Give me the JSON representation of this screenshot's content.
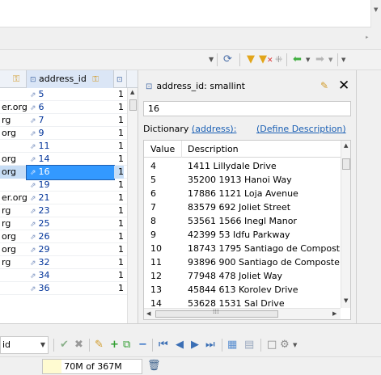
{
  "colors": {
    "selection": "#3399ff",
    "link": "#1a5fb4",
    "memory_fill": "#fffbd1"
  },
  "toolbar": {
    "icons": [
      "dropdown-icon",
      "refresh-icon",
      "filter-icon",
      "clear-filter-icon",
      "columns-icon",
      "back-icon",
      "forward-icon",
      "more-icon"
    ]
  },
  "grid": {
    "columns": [
      {
        "label": "",
        "icon": "key-sort-icon"
      },
      {
        "label": "address_id",
        "icon": "key-column-icon"
      },
      {
        "label": "",
        "icon": "column-icon"
      }
    ],
    "rows": [
      {
        "left": "",
        "id": "5",
        "right": "1"
      },
      {
        "left": "er.org",
        "id": "6",
        "right": "1"
      },
      {
        "left": "rg",
        "id": "7",
        "right": "1"
      },
      {
        "left": "org",
        "id": "9",
        "right": "1"
      },
      {
        "left": "",
        "id": "11",
        "right": "1"
      },
      {
        "left": "org",
        "id": "14",
        "right": "1"
      },
      {
        "left": "org",
        "id": "16",
        "right": "1",
        "selected": true
      },
      {
        "left": "",
        "id": "19",
        "right": "1"
      },
      {
        "left": "er.org",
        "id": "21",
        "right": "1"
      },
      {
        "left": "rg",
        "id": "23",
        "right": "1"
      },
      {
        "left": "rg",
        "id": "25",
        "right": "1"
      },
      {
        "left": "org",
        "id": "26",
        "right": "1"
      },
      {
        "left": "org",
        "id": "29",
        "right": "1"
      },
      {
        "left": "rg",
        "id": "32",
        "right": "1"
      },
      {
        "left": "",
        "id": "34",
        "right": "1"
      },
      {
        "left": "",
        "id": "36",
        "right": "1"
      }
    ]
  },
  "value_panel": {
    "title": "address_id: smallint",
    "value": "16",
    "dictionary_label": "Dictionary",
    "dictionary_link": "(address):",
    "define_link": "(Define Description)",
    "headers": {
      "value": "Value",
      "description": "Description"
    },
    "rows": [
      {
        "value": "4",
        "description": "1411 Lillydale Drive"
      },
      {
        "value": "5",
        "description": "35200 1913 Hanoi Way"
      },
      {
        "value": "6",
        "description": "17886 1121 Loja Avenue"
      },
      {
        "value": "7",
        "description": "83579 692 Joliet Street"
      },
      {
        "value": "8",
        "description": "53561 1566 Inegl Manor"
      },
      {
        "value": "9",
        "description": "42399 53 Idfu Parkway"
      },
      {
        "value": "10",
        "description": "18743 1795 Santiago de Compost"
      },
      {
        "value": "11",
        "description": "93896 900 Santiago de Composte"
      },
      {
        "value": "12",
        "description": "77948 478 Joliet Way"
      },
      {
        "value": "13",
        "description": "45844 613 Korolev Drive"
      },
      {
        "value": "14",
        "description": "53628 1531 Sal Drive"
      }
    ]
  },
  "navbar": {
    "column_select": "id"
  },
  "status": {
    "memory_text": "70M of 367M",
    "memory_fraction": 0.19
  }
}
